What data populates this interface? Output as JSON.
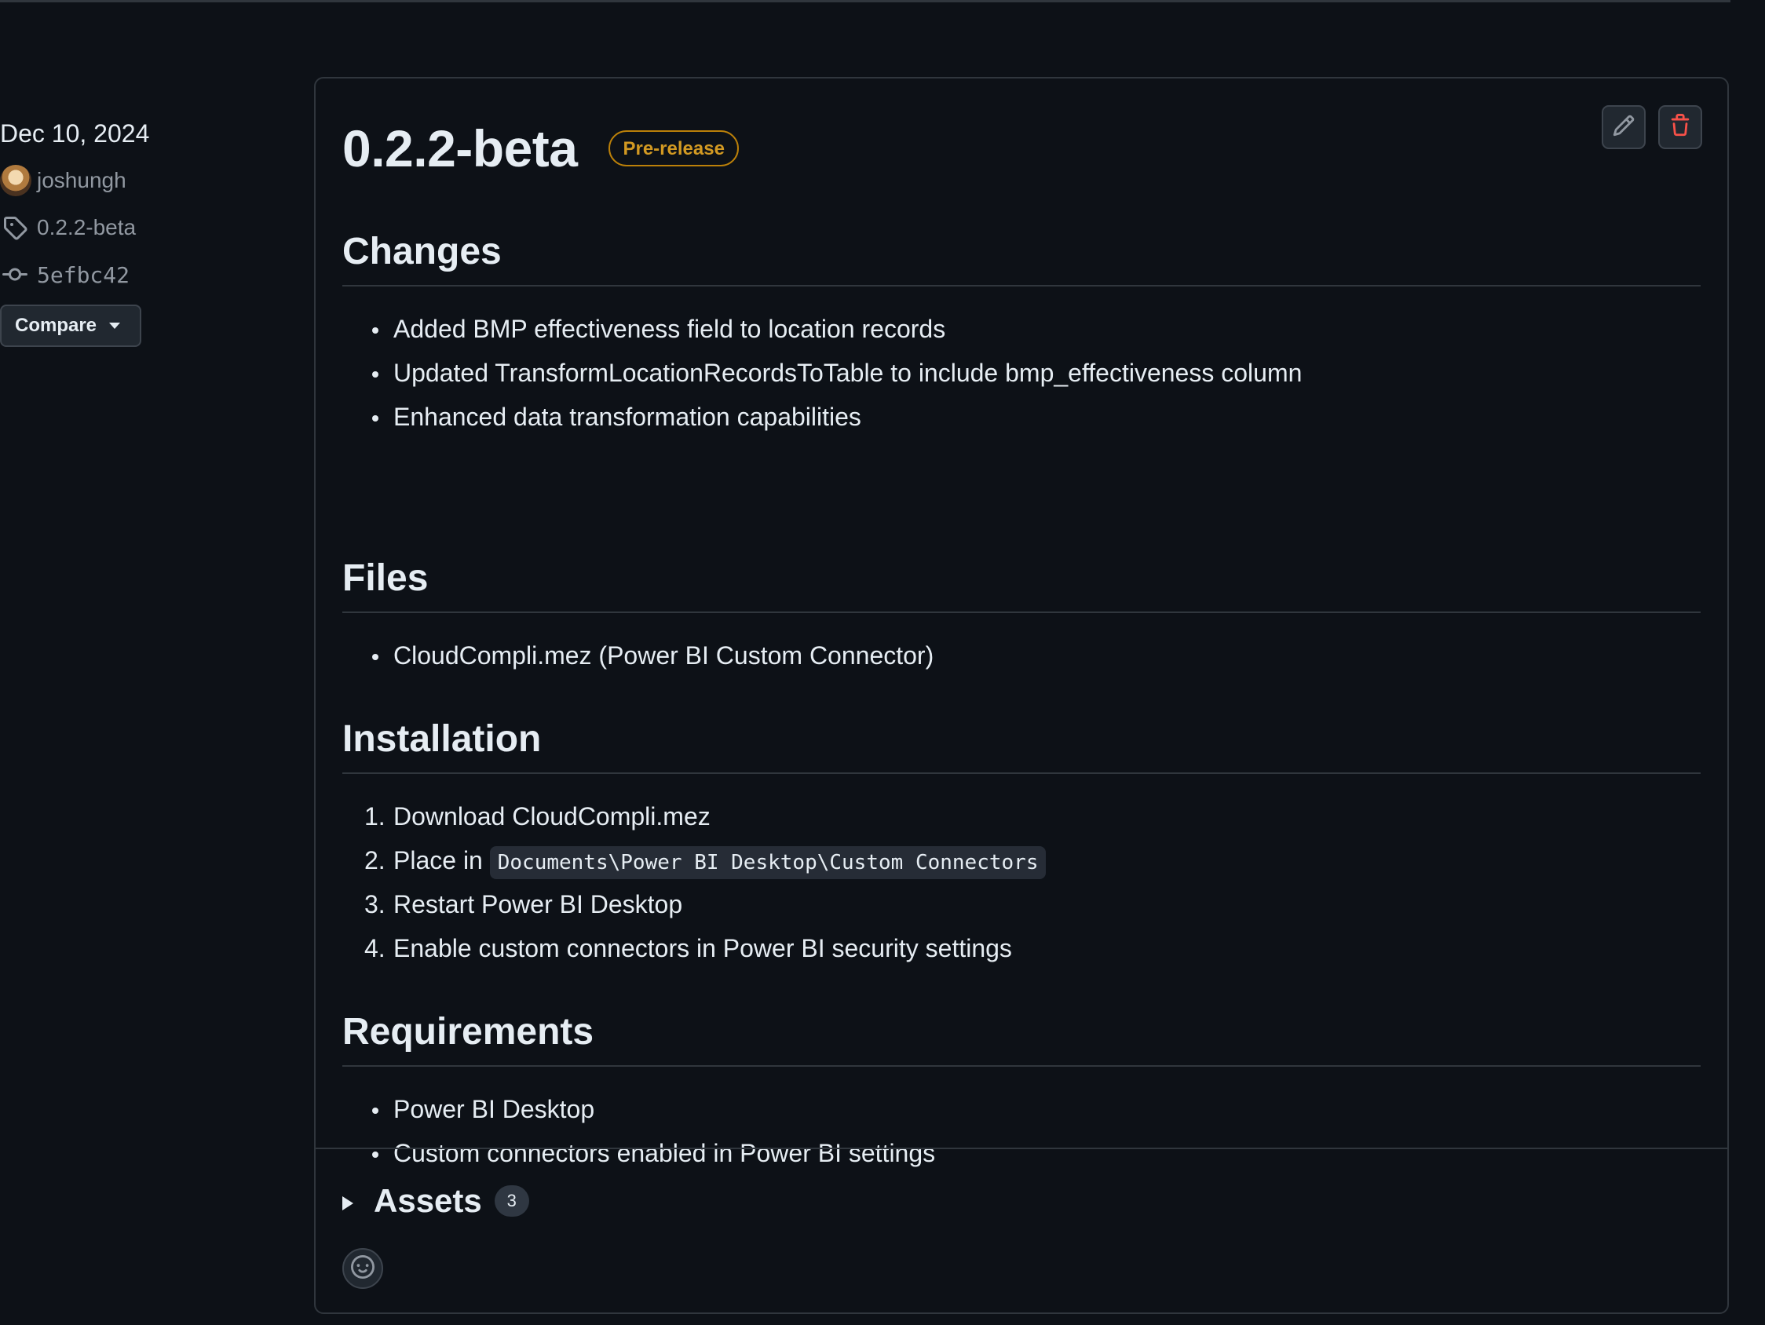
{
  "sidebar": {
    "date": "Dec 10, 2024",
    "author": "joshungh",
    "tag": "0.2.2-beta",
    "commit": "5efbc42",
    "compare_label": "Compare"
  },
  "release": {
    "title": "0.2.2-beta",
    "badge": "Pre-release",
    "sections": {
      "changes": {
        "heading": "Changes",
        "items": [
          "Added BMP effectiveness field to location records",
          "Updated TransformLocationRecordsToTable to include bmp_effectiveness column",
          "Enhanced data transformation capabilities"
        ]
      },
      "files": {
        "heading": "Files",
        "items": [
          "CloudCompli.mez (Power BI Custom Connector)"
        ]
      },
      "installation": {
        "heading": "Installation",
        "steps": [
          {
            "num": "1.",
            "text": "Download CloudCompli.mez"
          },
          {
            "num": "2.",
            "text": "Place in",
            "code": "Documents\\Power BI Desktop\\Custom Connectors"
          },
          {
            "num": "3.",
            "text": "Restart Power BI Desktop"
          },
          {
            "num": "4.",
            "text": "Enable custom connectors in Power BI security settings"
          }
        ]
      },
      "requirements": {
        "heading": "Requirements",
        "items": [
          "Power BI Desktop",
          "Custom connectors enabled in Power BI settings"
        ]
      }
    },
    "assets": {
      "label": "Assets",
      "count": "3"
    }
  },
  "colors": {
    "background": "#0d1117",
    "border": "#30363d",
    "prerelease": "#d29922",
    "danger": "#f85149"
  },
  "icons": [
    "tag-icon",
    "commit-icon",
    "pencil-icon",
    "trash-icon",
    "smiley-icon",
    "triangle-right-icon",
    "chevron-down-icon"
  ]
}
